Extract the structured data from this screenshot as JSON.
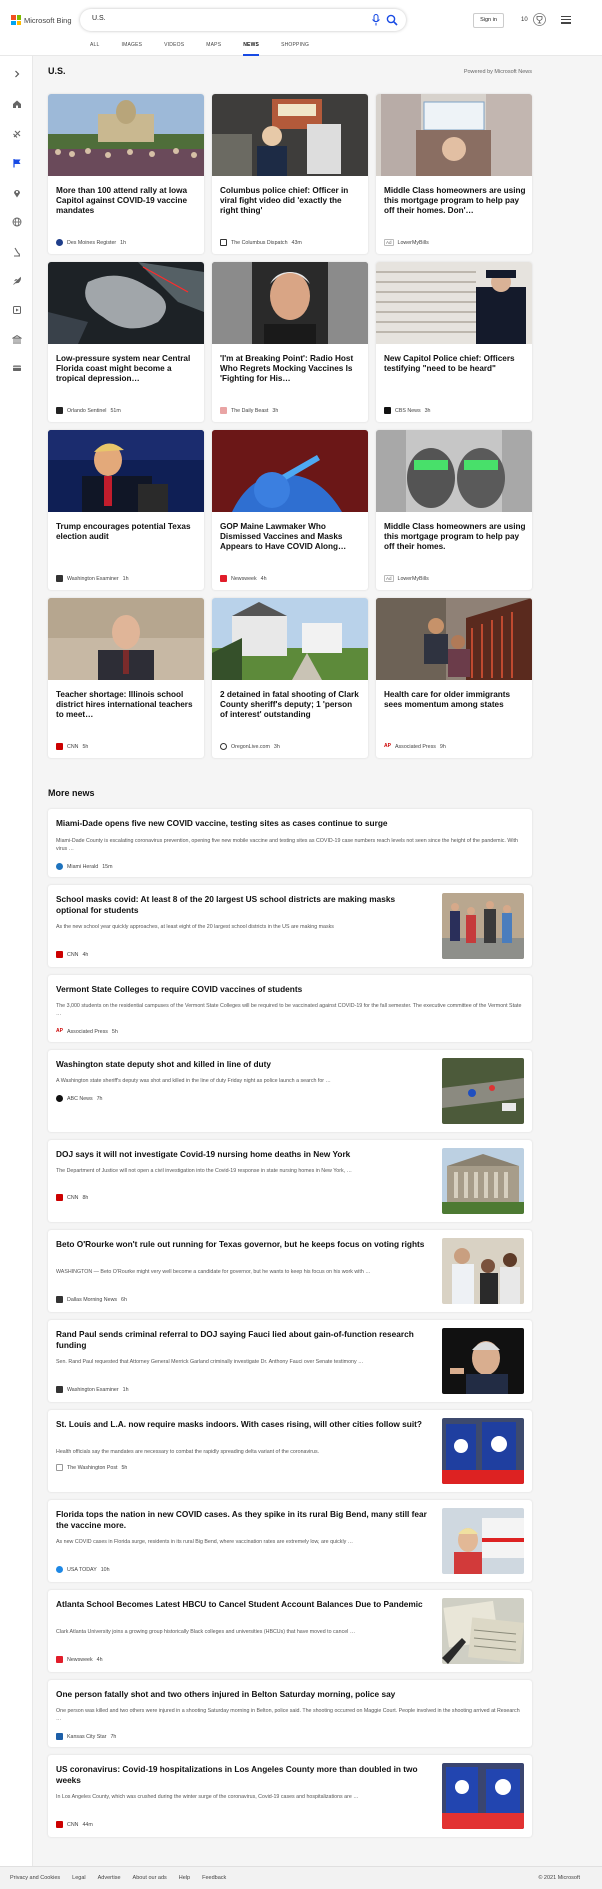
{
  "brand": {
    "logo_text": "Microsoft Bing",
    "accent": "#174ae4"
  },
  "search": {
    "query": "U.S."
  },
  "header": {
    "signin_label": "Sign in",
    "reward_points": "10"
  },
  "tabs": [
    {
      "label": "ALL"
    },
    {
      "label": "IMAGES"
    },
    {
      "label": "VIDEOS"
    },
    {
      "label": "MAPS"
    },
    {
      "label": "NEWS"
    },
    {
      "label": "SHOPPING"
    }
  ],
  "active_tab": "NEWS",
  "rail_icons": [
    "chevron-right-icon",
    "home-icon",
    "sports-icon",
    "flag-icon",
    "location-icon",
    "globe-icon",
    "science-icon",
    "rocket-icon",
    "entertainment-icon",
    "politics-icon",
    "money-icon"
  ],
  "section": {
    "title": "U.S.",
    "powered_by": "Powered by Microsoft News"
  },
  "cards": [
    {
      "title": "More than 100 attend rally at Iowa Capitol against COVID-19 vaccine mandates",
      "source": "Des Moines Register",
      "time": "1h",
      "ad": ""
    },
    {
      "title": "Columbus police chief: Officer in viral fight video did 'exactly the right thing'",
      "source": "The Columbus Dispatch",
      "time": "43m",
      "ad": ""
    },
    {
      "title": "Middle Class homeowners are using this mortgage program to help pay off their homes. Don'…",
      "source": "LowerMyBills",
      "time": "",
      "ad": "Ad"
    },
    {
      "title": "Low-pressure system near Central Florida coast might become a tropical depression…",
      "source": "Orlando Sentinel",
      "time": "51m",
      "ad": ""
    },
    {
      "title": "'I'm at Breaking Point': Radio Host Who Regrets Mocking Vaccines Is 'Fighting for His…",
      "source": "The Daily Beast",
      "time": "3h",
      "ad": ""
    },
    {
      "title": "New Capitol Police chief: Officers testifying \"need to be heard\"",
      "source": "CBS News",
      "time": "3h",
      "ad": ""
    },
    {
      "title": "Trump encourages potential Texas election audit",
      "source": "Washington Examiner",
      "time": "1h",
      "ad": ""
    },
    {
      "title": "GOP Maine Lawmaker Who Dismissed Vaccines and Masks Appears to Have COVID Along…",
      "source": "Newsweek",
      "time": "4h",
      "ad": ""
    },
    {
      "title": "Middle Class homeowners are using this mortgage program to help pay off their homes.",
      "source": "LowerMyBills",
      "time": "",
      "ad": "Ad"
    },
    {
      "title": "Teacher shortage: Illinois school district hires international teachers to meet…",
      "source": "CNN",
      "time": "5h",
      "ad": ""
    },
    {
      "title": "2 detained in fatal shooting of Clark County sheriff's deputy; 1 'person of interest' outstanding",
      "source": "OregonLive.com",
      "time": "3h",
      "ad": ""
    },
    {
      "title": "Health care for older immigrants sees momentum among states",
      "source": "Associated Press",
      "time": "9h",
      "ad": ""
    }
  ],
  "more_news": {
    "title": "More news",
    "items": [
      {
        "title": "Miami-Dade opens five new COVID vaccine, testing sites as cases continue to surge",
        "snippet": "Miami-Dade County is escalating coronavirus prevention, opening five new mobile vaccine and testing sites as COVID-19 case numbers reach levels not seen since the height of the pandemic. With virus …",
        "source": "Miami Herald",
        "time": "15m"
      },
      {
        "title": "School masks covid: At least 8 of the 20 largest US school districts are making masks optional for students",
        "snippet": "As the new school year quickly approaches, at least eight of the 20 largest school districts in the US are making masks",
        "source": "CNN",
        "time": "4h"
      },
      {
        "title": "Vermont State Colleges to require COVID vaccines of students",
        "snippet": "The 3,000 students on the residential campuses of the Vermont State Colleges will be required to be vaccinated against COVID-19 for the fall semester. The executive committee of the Vermont State …",
        "source": "Associated Press",
        "time": "5h"
      },
      {
        "title": "Washington state deputy shot and killed in line of duty",
        "snippet": "A Washington state sheriff's deputy was shot and killed in the line of duty Friday night as police launch a search for …",
        "source": "ABC News",
        "time": "7h"
      },
      {
        "title": "DOJ says it will not investigate Covid-19 nursing home deaths in New York",
        "snippet": "The Department of Justice will not open a civil investigation into the Covid-19 response in state nursing homes in New York, …",
        "source": "CNN",
        "time": "8h"
      },
      {
        "title": "Beto O'Rourke won't rule out running for Texas governor, but he keeps focus on voting rights",
        "snippet": "WASHINGTON — Beto O'Rourke might very well become a candidate for governor, but he wants to keep his focus on his work with …",
        "source": "Dallas Morning News",
        "time": "6h"
      },
      {
        "title": "Rand Paul sends criminal referral to DOJ saying Fauci lied about gain-of-function research funding",
        "snippet": "Sen. Rand Paul requested that Attorney General Merrick Garland criminally investigate Dr. Anthony Fauci over Senate testimony …",
        "source": "Washington Examiner",
        "time": "1h"
      },
      {
        "title": "St. Louis and L.A. now require masks indoors. With cases rising, will other cities follow suit?",
        "snippet": "Health officials say the mandates are necessary to combat the rapidly spreading delta variant of the coronavirus.",
        "source": "The Washington Post",
        "time": "5h"
      },
      {
        "title": "Florida tops the nation in new COVID cases. As they spike in its rural Big Bend, many still fear the vaccine more.",
        "snippet": "As new COVID cases in Florida surge, residents in its rural Big Bend, where vaccination rates are extremely low, are quickly …",
        "source": "USA TODAY",
        "time": "10h"
      },
      {
        "title": "Atlanta School Becomes Latest HBCU to Cancel Student Account Balances Due to Pandemic",
        "snippet": "Clark Atlanta University joins a growing group historically Black colleges and universities (HBCUs) that have moved to cancel …",
        "source": "Newsweek",
        "time": "4h"
      },
      {
        "title": "One person fatally shot and two others injured in Belton Saturday morning, police say",
        "snippet": "One person was killed and two others were injured in a shooting Saturday morning in Belton, police said. The shooting occurred on Maggie Court. People involved in the shooting arrived at Research …",
        "source": "Kansas City Star",
        "time": "7h"
      },
      {
        "title": "US coronavirus: Covid-19 hospitalizations in Los Angeles County more than doubled in two weeks",
        "snippet": "In Los Angeles County, which was crushed during the winter surge of the coronavirus, Covid-19 cases and hospitalizations are …",
        "source": "CNN",
        "time": "44m"
      }
    ]
  },
  "footer": {
    "links": [
      "Privacy and Cookies",
      "Legal",
      "Advertise",
      "About our ads",
      "Help",
      "Feedback"
    ],
    "copyright": "© 2021 Microsoft"
  }
}
